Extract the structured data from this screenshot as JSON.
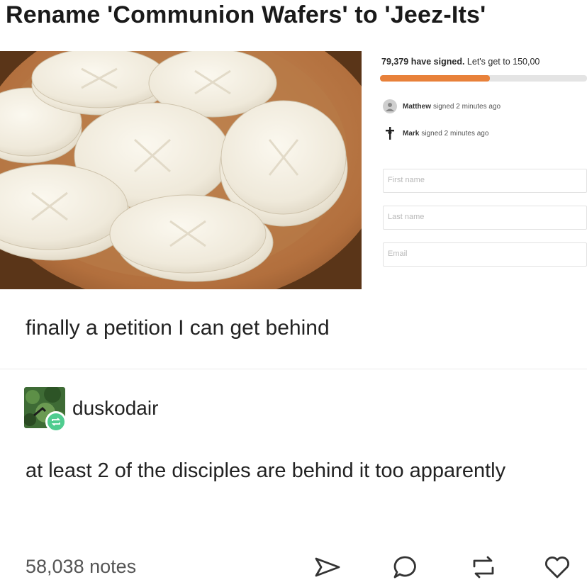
{
  "post": {
    "title": "Rename 'Communion Wafers' to 'Jeez-Its'",
    "caption": "finally a petition I can get behind",
    "notes_count": "58,038 notes"
  },
  "petition": {
    "signed_count": "79,379 have signed.",
    "goal_text": "Let's get to 150,00",
    "progress_fraction": 0.53,
    "accent_color": "#e8813a",
    "signers": [
      {
        "name": "Matthew",
        "text": "signed 2 minutes ago",
        "icon": "person-icon"
      },
      {
        "name": "Mark",
        "text": "signed 2 minutes ago",
        "icon": "cross-icon"
      }
    ],
    "fields": [
      {
        "placeholder": "First name"
      },
      {
        "placeholder": "Last name"
      },
      {
        "placeholder": "Email"
      }
    ]
  },
  "reblog": {
    "username": "duskodair",
    "text": "at least 2 of the disciples are behind it too apparently",
    "badge_color": "#4fcc8f"
  },
  "actions": [
    {
      "name": "share-icon"
    },
    {
      "name": "reply-icon"
    },
    {
      "name": "reblog-icon"
    },
    {
      "name": "like-icon"
    }
  ]
}
